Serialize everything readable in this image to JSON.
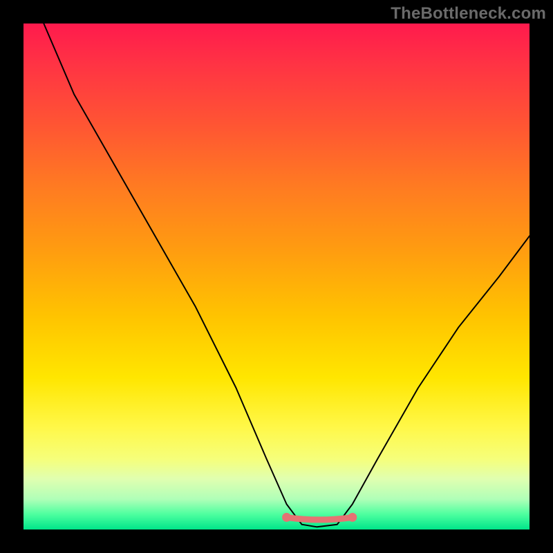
{
  "watermark": "TheBottleneck.com",
  "chart_data": {
    "type": "line",
    "title": "",
    "xlabel": "",
    "ylabel": "",
    "xlim": [
      0,
      100
    ],
    "ylim": [
      0,
      100
    ],
    "series": [
      {
        "name": "bottleneck-curve",
        "x": [
          4,
          10,
          18,
          26,
          34,
          42,
          48,
          52,
          55,
          58,
          62,
          65,
          70,
          78,
          86,
          94,
          100
        ],
        "y": [
          100,
          86,
          72,
          58,
          44,
          28,
          14,
          5,
          1,
          0.5,
          1,
          5,
          14,
          28,
          40,
          50,
          58
        ]
      }
    ],
    "trough_segment": {
      "x_start": 52,
      "x_end": 65,
      "y": 2
    },
    "colors": {
      "curve": "#000000",
      "trough_marker": "#e57373",
      "gradient_top": "#ff1a4d",
      "gradient_bottom": "#00e58a",
      "frame": "#000000"
    }
  }
}
